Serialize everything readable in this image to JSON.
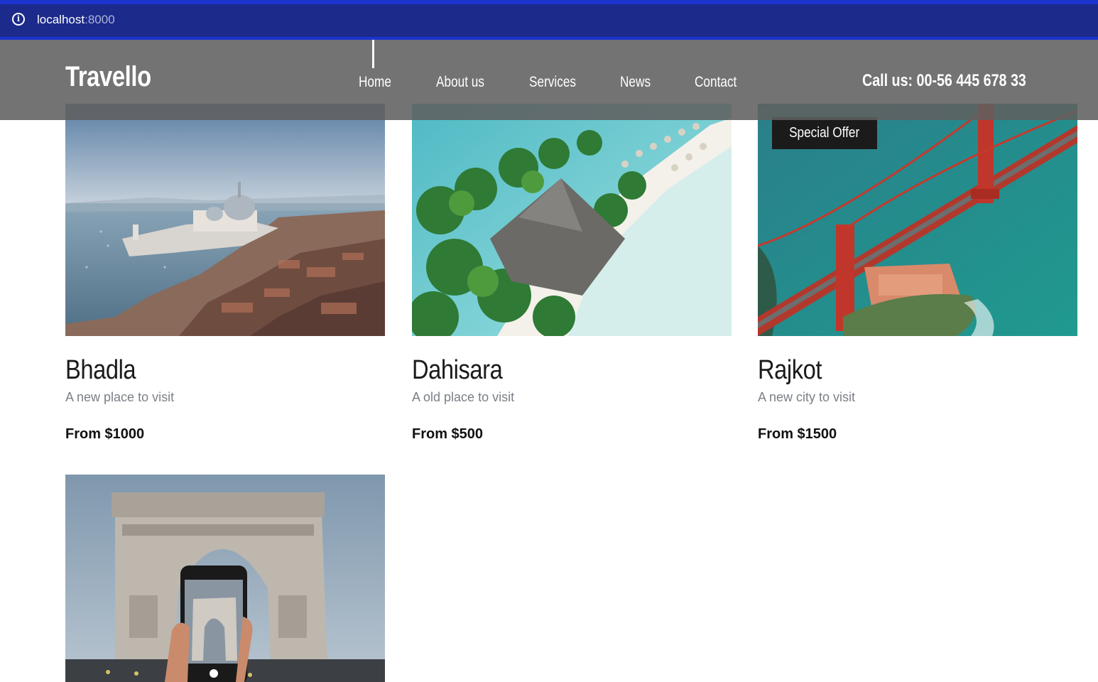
{
  "browser": {
    "url_host": "localhost",
    "url_port": ":8000"
  },
  "header": {
    "logo": "Travello",
    "nav": [
      {
        "label": "Home",
        "active": true
      },
      {
        "label": "About us"
      },
      {
        "label": "Services"
      },
      {
        "label": "News"
      },
      {
        "label": "Contact"
      }
    ],
    "call_us": "Call us: 00-56 445 678 33"
  },
  "destinations": [
    {
      "name": "Bhadla",
      "tagline": "A new place to visit",
      "price": "From $1000",
      "image": "venice-city-aerial"
    },
    {
      "name": "Dahisara",
      "tagline": "A old place to visit",
      "price": "From $500",
      "image": "tropical-island-beach"
    },
    {
      "name": "Rajkot",
      "tagline": "A new city to visit",
      "price": "From $1500",
      "image": "golden-gate-bridge",
      "badge": "Special Offer"
    },
    {
      "name": "",
      "tagline": "",
      "price": "",
      "image": "arc-de-triomphe-phone"
    }
  ],
  "colors": {
    "address_bar": "#1c2a8c",
    "address_bar_border": "#1b33cf",
    "header_overlay": "#606060",
    "badge_bg": "#1b1b1b"
  }
}
